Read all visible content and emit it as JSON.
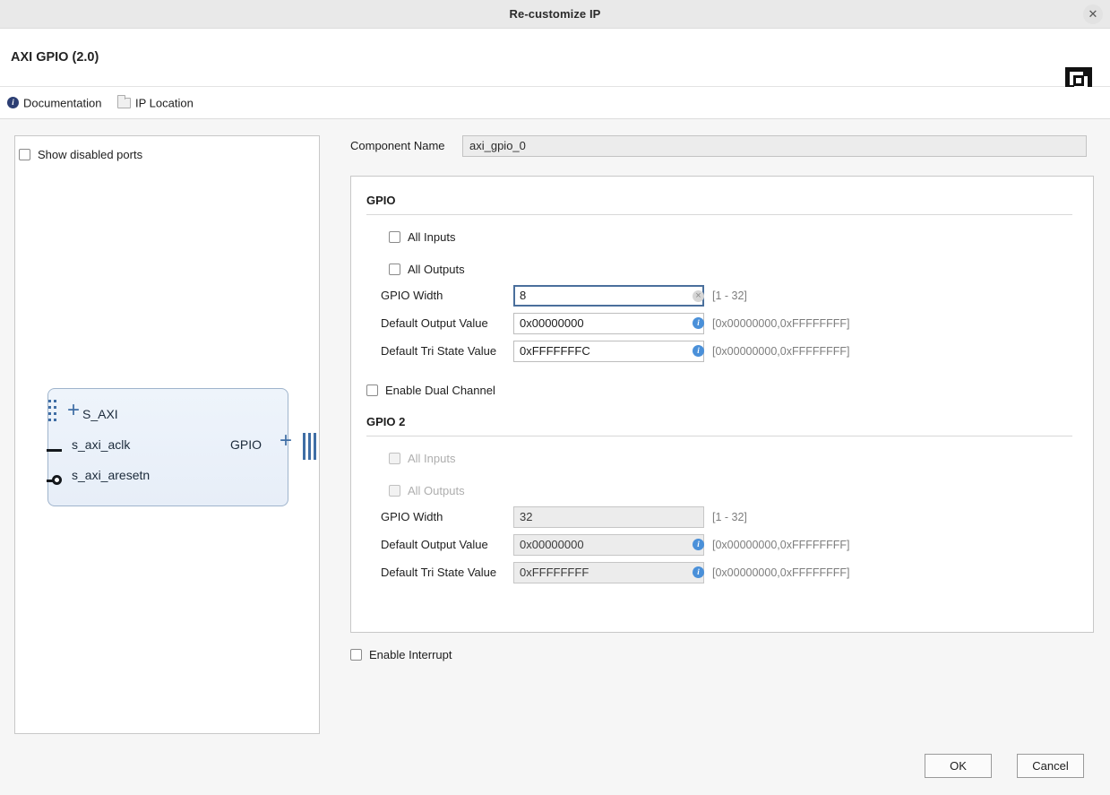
{
  "window": {
    "title": "Re-customize IP",
    "close_icon": "close-icon"
  },
  "ip_header": {
    "title": "AXI GPIO (2.0)",
    "logo": "xilinx-logo"
  },
  "linkbar": {
    "documentation": "Documentation",
    "ip_location": "IP Location"
  },
  "left_panel": {
    "show_disabled_ports": "Show disabled ports",
    "diagram": {
      "ports_left": [
        "S_AXI",
        "s_axi_aclk",
        "s_axi_aresetn"
      ],
      "ports_right": [
        "GPIO"
      ]
    }
  },
  "component": {
    "label": "Component Name",
    "value": "axi_gpio_0"
  },
  "gpio": {
    "title": "GPIO",
    "all_inputs": "All Inputs",
    "all_outputs": "All Outputs",
    "width_label": "GPIO Width",
    "width_value": "8",
    "width_hint": "[1 - 32]",
    "out_label": "Default Output Value",
    "out_value": "0x00000000",
    "out_hint": "[0x00000000,0xFFFFFFFF]",
    "tri_label": "Default Tri State Value",
    "tri_value": "0xFFFFFFFC",
    "tri_hint": "[0x00000000,0xFFFFFFFF]"
  },
  "dual_channel": {
    "label": "Enable Dual Channel"
  },
  "gpio2": {
    "title": "GPIO 2",
    "all_inputs": "All Inputs",
    "all_outputs": "All Outputs",
    "width_label": "GPIO Width",
    "width_value": "32",
    "width_hint": "[1 - 32]",
    "out_label": "Default Output Value",
    "out_value": "0x00000000",
    "out_hint": "[0x00000000,0xFFFFFFFF]",
    "tri_label": "Default Tri State Value",
    "tri_value": "0xFFFFFFFF",
    "tri_hint": "[0x00000000,0xFFFFFFFF]"
  },
  "interrupt": {
    "label": "Enable Interrupt"
  },
  "footer": {
    "ok": "OK",
    "cancel": "Cancel"
  },
  "colors": {
    "accent_blue": "#3f6ea5",
    "focus_border": "#4a6f9c",
    "info_blue": "#4a90d9",
    "doc_icon": "#2c3e73"
  }
}
